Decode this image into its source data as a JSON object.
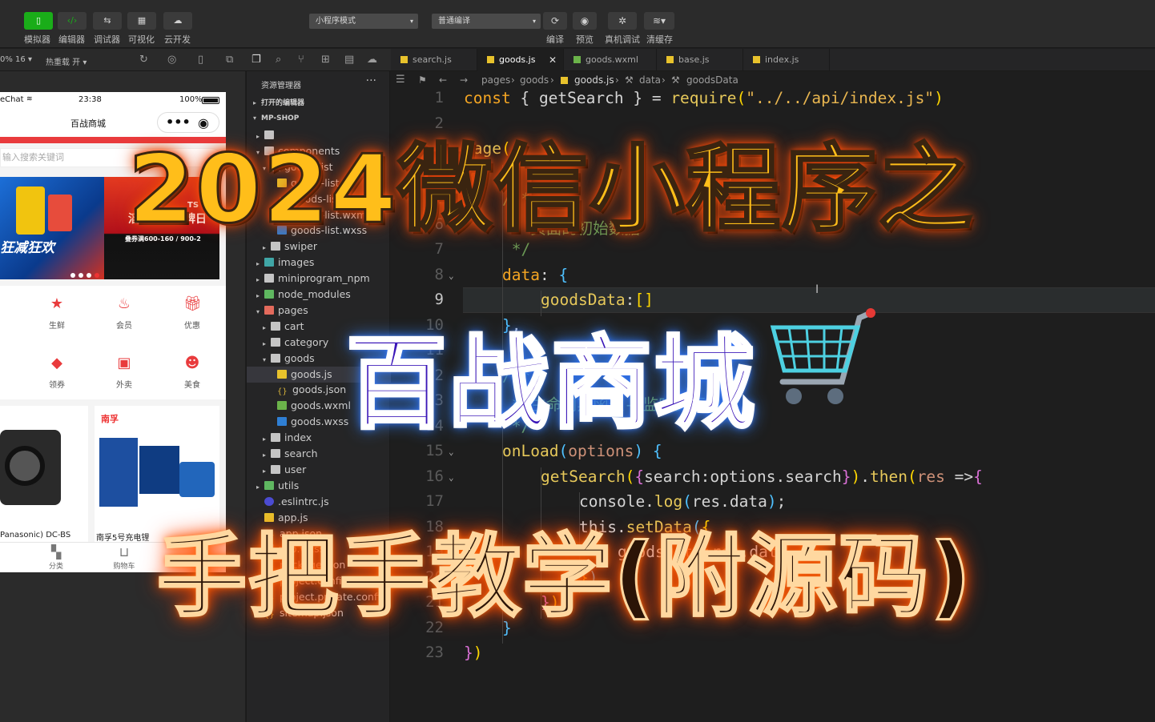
{
  "toolbar": {
    "mode_buttons": [
      {
        "label": "模拟器",
        "icon": "phone-icon"
      },
      {
        "label": "编辑器",
        "icon": "code-icon"
      },
      {
        "label": "调试器",
        "icon": "debug-icon"
      },
      {
        "label": "可视化",
        "icon": "layout-icon"
      },
      {
        "label": "云开发",
        "icon": "cloud-icon"
      }
    ],
    "mode_select": "小程序模式",
    "compile_select": "普通编译",
    "actions": [
      "编译",
      "预览",
      "真机调试",
      "清缓存"
    ]
  },
  "subbar": {
    "zoom": "0% 16 ▾",
    "hot_reload": "热重载 开 ▾"
  },
  "phone": {
    "carrier": "eChat",
    "time": "23:38",
    "battery": "100%",
    "title": "百战商城",
    "search_placeholder": "输入搜索关键词",
    "banner_left_text": "狂减狂欢",
    "banner_right_title": "滔搏燃动大牌日",
    "banner_right_sub": "叠券满600-160 / 900-2",
    "banner_right_brand": "TS",
    "grid": [
      {
        "label": "生鲜",
        "icon": "star-icon"
      },
      {
        "label": "会员",
        "icon": "flame-icon"
      },
      {
        "label": "优惠",
        "icon": "gift-icon"
      },
      {
        "label": "领券",
        "icon": "diamond-icon"
      },
      {
        "label": "外卖",
        "icon": "bag-icon"
      },
      {
        "label": "美食",
        "icon": "smile-icon"
      }
    ],
    "goods": [
      {
        "name": "Panasonic) DC-BS"
      },
      {
        "name": "南孚5号充电锂"
      }
    ],
    "goods_brand": "南孚",
    "tabs": [
      {
        "label": "分类",
        "icon": "category-icon"
      },
      {
        "label": "购物车",
        "icon": "cart-icon"
      }
    ]
  },
  "explorer": {
    "title": "资源管理器",
    "open_editors": "打开的编辑器",
    "project": "MP-SHOP",
    "tree": [
      {
        "name": "",
        "type": "folder",
        "depth": 1,
        "open": false
      },
      {
        "name": "components",
        "type": "folder",
        "depth": 1,
        "open": true
      },
      {
        "name": "goods-list",
        "type": "folder",
        "depth": 2,
        "open": true
      },
      {
        "name": "goods-list.js",
        "type": "js",
        "depth": 3
      },
      {
        "name": "goods-list.json",
        "type": "json",
        "depth": 3
      },
      {
        "name": "goods-list.wxml",
        "type": "wxml",
        "depth": 3
      },
      {
        "name": "goods-list.wxss",
        "type": "wxss",
        "depth": 3
      },
      {
        "name": "swiper",
        "type": "folder",
        "depth": 2,
        "open": false
      },
      {
        "name": "images",
        "type": "folder-teal",
        "depth": 1,
        "open": false
      },
      {
        "name": "miniprogram_npm",
        "type": "folder",
        "depth": 1,
        "open": false
      },
      {
        "name": "node_modules",
        "type": "folder-green",
        "depth": 1,
        "open": false
      },
      {
        "name": "pages",
        "type": "folder-red",
        "depth": 1,
        "open": true
      },
      {
        "name": "cart",
        "type": "folder",
        "depth": 2,
        "open": false
      },
      {
        "name": "category",
        "type": "folder",
        "depth": 2,
        "open": false
      },
      {
        "name": "goods",
        "type": "folder",
        "depth": 2,
        "open": true
      },
      {
        "name": "goods.js",
        "type": "js",
        "depth": 3,
        "active": true
      },
      {
        "name": "goods.json",
        "type": "json",
        "depth": 3
      },
      {
        "name": "goods.wxml",
        "type": "wxml",
        "depth": 3
      },
      {
        "name": "goods.wxss",
        "type": "wxss",
        "depth": 3
      },
      {
        "name": "index",
        "type": "folder",
        "depth": 2,
        "open": false
      },
      {
        "name": "search",
        "type": "folder",
        "depth": 2,
        "open": false
      },
      {
        "name": "user",
        "type": "folder",
        "depth": 2,
        "open": false
      },
      {
        "name": "utils",
        "type": "folder-green",
        "depth": 1,
        "open": false
      },
      {
        "name": ".eslintrc.js",
        "type": "eslint",
        "depth": 1
      },
      {
        "name": "app.js",
        "type": "js",
        "depth": 1
      },
      {
        "name": "app.json",
        "type": "json",
        "depth": 1
      },
      {
        "name": "app.wxss",
        "type": "wxss",
        "depth": 1
      },
      {
        "name": "package.json",
        "type": "json",
        "depth": 1
      },
      {
        "name": "project.config.json",
        "type": "json",
        "depth": 1
      },
      {
        "name": "project.private.config...",
        "type": "json",
        "depth": 1
      },
      {
        "name": "sitemap.json",
        "type": "json",
        "depth": 1
      }
    ]
  },
  "editor": {
    "tabs": [
      {
        "name": "search.js",
        "active": false
      },
      {
        "name": "goods.js",
        "active": true
      },
      {
        "name": "goods.wxml",
        "active": false
      },
      {
        "name": "base.js",
        "active": false
      },
      {
        "name": "index.js",
        "active": false
      }
    ],
    "breadcrumb": [
      "pages",
      "goods",
      "goods.js",
      "data",
      "goodsData"
    ],
    "lines": [
      {
        "n": "1",
        "text": "const { getSearch } = require(\"../../api/index.js\")"
      },
      {
        "n": "2",
        "text": ""
      },
      {
        "n": "3",
        "text": "Page({"
      },
      {
        "n": "4",
        "text": ""
      },
      {
        "n": "5",
        "text": "/**"
      },
      {
        "n": "6",
        "text": " * 页面的初始数据"
      },
      {
        "n": "7",
        "text": " */"
      },
      {
        "n": "8",
        "text": "data: {"
      },
      {
        "n": "9",
        "text": "goodsData:[]"
      },
      {
        "n": "10",
        "text": "},"
      },
      {
        "n": "11",
        "text": ""
      },
      {
        "n": "12",
        "text": "/**"
      },
      {
        "n": "13",
        "text": " * 生命周期函数--监听页面加载"
      },
      {
        "n": "14",
        "text": " */"
      },
      {
        "n": "15",
        "text": "onLoad(options) {"
      },
      {
        "n": "16",
        "text": "getSearch({search:options.search}).then(res =>{"
      },
      {
        "n": "17",
        "text": "console.log(res.data);"
      },
      {
        "n": "18",
        "text": "this.setData({"
      },
      {
        "n": "19",
        "text": "goodsData:res.data"
      },
      {
        "n": "20",
        "text": "})"
      },
      {
        "n": "21",
        "text": "})"
      },
      {
        "n": "22",
        "text": "}"
      },
      {
        "n": "23",
        "text": "})"
      }
    ]
  },
  "overlay": {
    "title": "2024微信小程序之",
    "shop": "百战商城",
    "teach": "手把手教学(附源码)"
  },
  "colors": {
    "keyword": "#f5a623",
    "comment": "#6a9955",
    "accent_red": "#e93b3d",
    "tool_green": "#1aad19"
  }
}
